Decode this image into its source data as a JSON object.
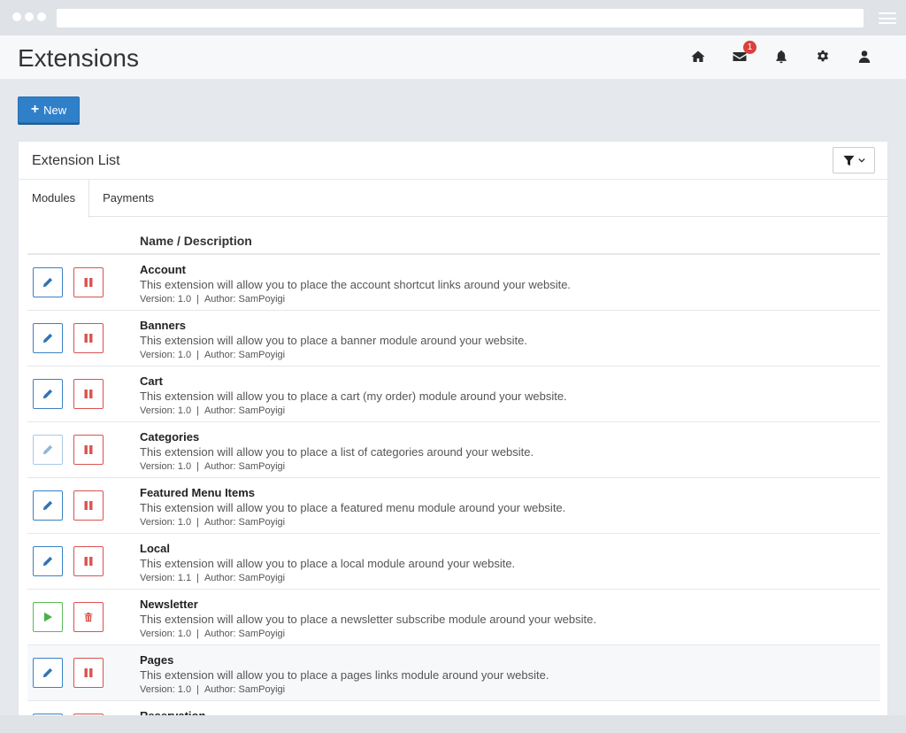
{
  "header": {
    "title": "Extensions",
    "mail_badge": "1"
  },
  "toolbar": {
    "new_label": "New"
  },
  "panel": {
    "title": "Extension List",
    "tabs": [
      {
        "label": "Modules",
        "active": true
      },
      {
        "label": "Payments",
        "active": false
      }
    ],
    "column_header": "Name / Description",
    "version_label": "Version:",
    "author_label": "Author:",
    "separator": "|",
    "rows": [
      {
        "name": "Account",
        "description": "This extension will allow you to place the account shortcut links around your website.",
        "version": "1.0",
        "author": "SamPoyigi",
        "installed": true
      },
      {
        "name": "Banners",
        "description": "This extension will allow you to place a banner module around your website.",
        "version": "1.0",
        "author": "SamPoyigi",
        "installed": true
      },
      {
        "name": "Cart",
        "description": "This extension will allow you to place a cart (my order) module around your website.",
        "version": "1.0",
        "author": "SamPoyigi",
        "installed": true
      },
      {
        "name": "Categories",
        "description": "This extension will allow you to place a list of categories around your website.",
        "version": "1.0",
        "author": "SamPoyigi",
        "installed": true,
        "edit_disabled": true
      },
      {
        "name": "Featured Menu Items",
        "description": "This extension will allow you to place a featured menu module around your website.",
        "version": "1.0",
        "author": "SamPoyigi",
        "installed": true
      },
      {
        "name": "Local",
        "description": "This extension will allow you to place a local module around your website.",
        "version": "1.1",
        "author": "SamPoyigi",
        "installed": true
      },
      {
        "name": "Newsletter",
        "description": "This extension will allow you to place a newsletter subscribe module around your website.",
        "version": "1.0",
        "author": "SamPoyigi",
        "installed": false
      },
      {
        "name": "Pages",
        "description": "This extension will allow you to place a pages links module around your website.",
        "version": "1.0",
        "author": "SamPoyigi",
        "installed": true
      },
      {
        "name": "Reservation",
        "description": "",
        "version": "",
        "author": "",
        "installed": true
      }
    ]
  },
  "colors": {
    "primary": "#2f80c9",
    "danger": "#d9534f",
    "success": "#5cb85c",
    "badge": "#d9413c"
  }
}
